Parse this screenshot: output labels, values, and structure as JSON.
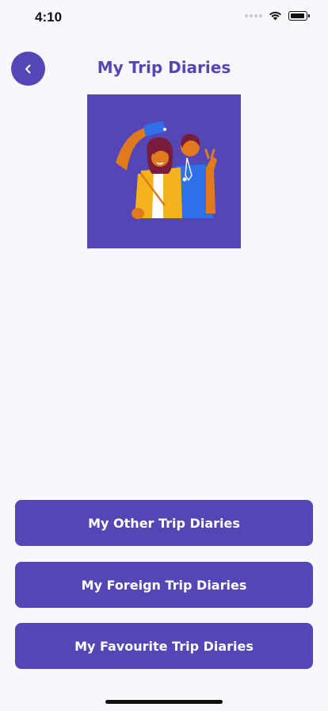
{
  "status_bar": {
    "time": "4:10",
    "icons": [
      "signal-icon",
      "wifi-icon",
      "battery-icon"
    ]
  },
  "header": {
    "back_icon": "chevron-left-icon",
    "title": "My Trip Diaries"
  },
  "hero": {
    "icon": "travel-friends-selfie-illustration"
  },
  "buttons": [
    {
      "label": "My Other Trip Diaries"
    },
    {
      "label": "My Foreign Trip Diaries"
    },
    {
      "label": "My Favourite Trip Diaries"
    }
  ],
  "colors": {
    "accent": "#5446b4",
    "background": "#f8f7fc",
    "button_text": "#ffffff"
  }
}
